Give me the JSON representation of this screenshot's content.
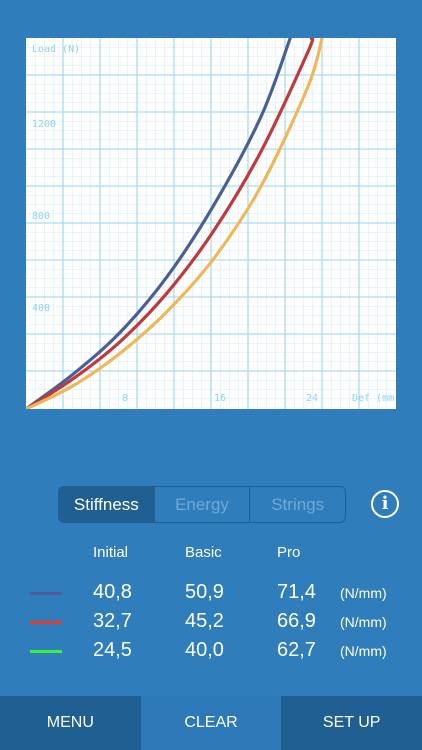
{
  "chart_data": {
    "type": "line",
    "xlabel": "Def (mm)",
    "ylabel": "Load (N)",
    "x_ticks": [
      "8",
      "16",
      "24"
    ],
    "y_ticks": [
      "400",
      "800",
      "1200"
    ],
    "xlim": [
      0,
      31.5
    ],
    "ylim": [
      0,
      1600
    ],
    "grid": true,
    "series": [
      {
        "color": "#4a5f96",
        "x": [
          0,
          4,
          8,
          12,
          16,
          20,
          22.5
        ],
        "y": [
          0,
          150,
          330,
          570,
          880,
          1260,
          1600
        ]
      },
      {
        "color": "#c0393b",
        "x": [
          0,
          4,
          8,
          12,
          16,
          20,
          24,
          24.3
        ],
        "y": [
          0,
          130,
          290,
          500,
          770,
          1110,
          1540,
          1600
        ]
      },
      {
        "color": "#f0b657",
        "x": [
          0,
          4,
          8,
          12,
          16,
          20,
          24,
          25.2
        ],
        "y": [
          0,
          100,
          240,
          420,
          650,
          960,
          1390,
          1600
        ]
      }
    ]
  },
  "tabs": [
    {
      "label": "Stiffness",
      "active": true
    },
    {
      "label": "Energy",
      "active": false
    },
    {
      "label": "Strings",
      "active": false
    }
  ],
  "info_icon": "info-icon",
  "table": {
    "headers": [
      "Initial",
      "Basic",
      "Pro"
    ],
    "unit": "(N/mm)",
    "rows": [
      {
        "color": "#4a5f96",
        "values": [
          "40,8",
          "50,9",
          "71,4"
        ]
      },
      {
        "color": "#e43a30",
        "values": [
          "32,7",
          "45,2",
          "66,9"
        ]
      },
      {
        "color": "#3ef03c",
        "values": [
          "24,5",
          "40,0",
          "62,7"
        ]
      }
    ]
  },
  "toolbar": {
    "menu": "MENU",
    "clear": "CLEAR",
    "setup": "SET UP"
  }
}
